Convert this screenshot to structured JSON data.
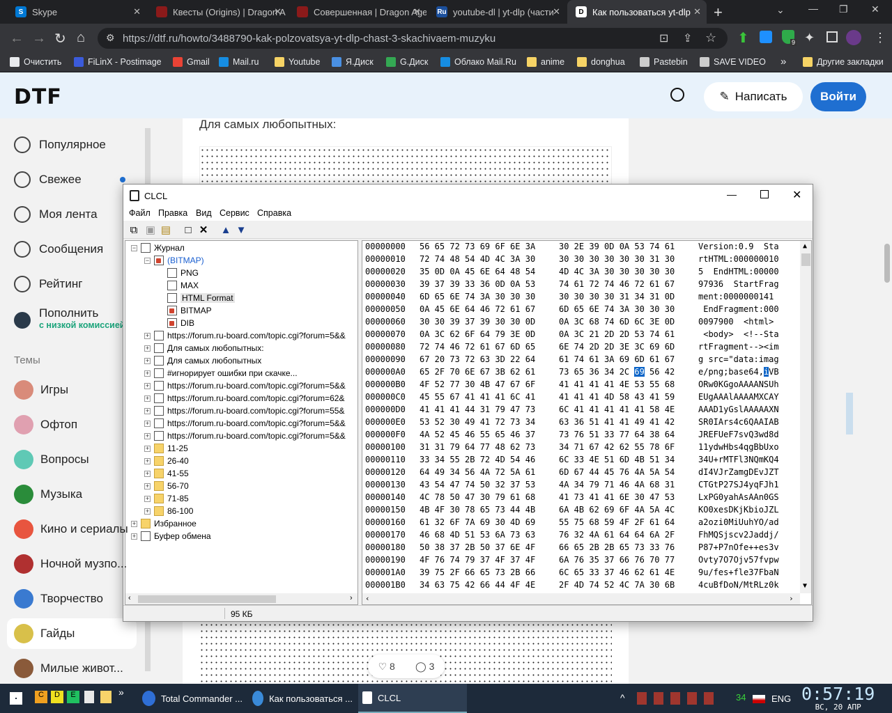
{
  "browser": {
    "tabs": [
      {
        "title": "Skype",
        "favicon_color": "#0078d4",
        "favicon_letter": "S"
      },
      {
        "title": "Квесты (Origins) | Dragon A",
        "favicon_color": "#8b1a1a",
        "favicon_letter": ""
      },
      {
        "title": "Совершенная | Dragon Age",
        "favicon_color": "#8b1a1a",
        "favicon_letter": ""
      },
      {
        "title": "youtube-dl | yt-dlp (части",
        "favicon_color": "#1b4f9c",
        "favicon_letter": "Ru"
      },
      {
        "title": "Как пользоваться yt-dlp",
        "favicon_color": "#ffffff",
        "favicon_letter": "D"
      }
    ],
    "active_tab": 4,
    "new_tab": "+",
    "url": "https://dtf.ru/howto/3488790-kak-polzovatsya-yt-dlp-chast-3-skachivaem-muzyku",
    "bookmarks": [
      {
        "label": "Очистить",
        "color": "#e8eaed"
      },
      {
        "label": "FiLinX - Postimage",
        "color": "#3b5bdb"
      },
      {
        "label": "Gmail",
        "color": "#ea4335"
      },
      {
        "label": "Mail.ru",
        "color": "#168de2"
      },
      {
        "label": "Youtube",
        "color": "#f6d365"
      },
      {
        "label": "Я.Диск",
        "color": "#4a90e2"
      },
      {
        "label": "G.Диск",
        "color": "#34a853"
      },
      {
        "label": "Облако Mail.Ru",
        "color": "#168de2"
      },
      {
        "label": "anime",
        "color": "#f6d365"
      },
      {
        "label": "donghua",
        "color": "#f6d365"
      },
      {
        "label": "Pastebin",
        "color": "#cccccc"
      },
      {
        "label": "SAVE VIDEO",
        "color": "#cccccc"
      }
    ],
    "bookmarks_more": "»",
    "other_bookmarks": "Другие закладки",
    "extension_badge": "9"
  },
  "site": {
    "logo": "DTF",
    "write_button": "Написать",
    "login_button": "Войти",
    "nav": [
      {
        "label": "Популярное"
      },
      {
        "label": "Свежее"
      },
      {
        "label": "Моя лента"
      },
      {
        "label": "Сообщения"
      },
      {
        "label": "Рейтинг"
      }
    ],
    "topup": {
      "label": "Пополнить",
      "sub": "с низкой комиссией"
    },
    "topics_heading": "Темы",
    "topics": [
      {
        "label": "Игры",
        "color": "#d98b7a"
      },
      {
        "label": "Офтоп",
        "color": "#e0a0b0"
      },
      {
        "label": "Вопросы",
        "color": "#5fc9b5"
      },
      {
        "label": "Музыка",
        "color": "#2a8c3a"
      },
      {
        "label": "Кино и сериалы",
        "color": "#e8553f"
      },
      {
        "label": "Ночной музпо...",
        "color": "#b03030"
      },
      {
        "label": "Творчество",
        "color": "#3a7ad0"
      },
      {
        "label": "Гайды",
        "color": "#d8c04a"
      },
      {
        "label": "Милые живот...",
        "color": "#8a5a3a"
      }
    ],
    "article_text": "Для самых любопытных:",
    "likes": "8",
    "comments": "3"
  },
  "clcl": {
    "title": "CLCL",
    "menu": [
      "Файл",
      "Правка",
      "Вид",
      "Сервис",
      "Справка"
    ],
    "tree": [
      {
        "label": "Журнал",
        "level": 0,
        "icon": "doc",
        "exp": "−"
      },
      {
        "label": "(BITMAP)",
        "level": 1,
        "icon": "bmp",
        "exp": "−",
        "selected": true
      },
      {
        "label": "PNG",
        "level": 2,
        "icon": "doc",
        "exp": ""
      },
      {
        "label": "MAX",
        "level": 2,
        "icon": "doc",
        "exp": ""
      },
      {
        "label": "HTML Format",
        "level": 2,
        "icon": "doc",
        "exp": "",
        "focus": true
      },
      {
        "label": "BITMAP",
        "level": 2,
        "icon": "bmp",
        "exp": ""
      },
      {
        "label": "DIB",
        "level": 2,
        "icon": "bmp",
        "exp": ""
      },
      {
        "label": "https://forum.ru-board.com/topic.cgi?forum=5&&",
        "level": 1,
        "icon": "doc",
        "exp": "+"
      },
      {
        "label": "Для самых любопытных:",
        "level": 1,
        "icon": "doc",
        "exp": "+"
      },
      {
        "label": "Для самых любопытных",
        "level": 1,
        "icon": "doc",
        "exp": "+"
      },
      {
        "label": "#игнорирует ошибки при скачке...",
        "level": 1,
        "icon": "doc",
        "exp": "+"
      },
      {
        "label": "https://forum.ru-board.com/topic.cgi?forum=5&&",
        "level": 1,
        "icon": "doc",
        "exp": "+"
      },
      {
        "label": "https://forum.ru-board.com/topic.cgi?forum=62&",
        "level": 1,
        "icon": "doc",
        "exp": "+"
      },
      {
        "label": "https://forum.ru-board.com/topic.cgi?forum=55&",
        "level": 1,
        "icon": "doc",
        "exp": "+"
      },
      {
        "label": "https://forum.ru-board.com/topic.cgi?forum=5&&",
        "level": 1,
        "icon": "doc",
        "exp": "+"
      },
      {
        "label": "https://forum.ru-board.com/topic.cgi?forum=5&&",
        "level": 1,
        "icon": "doc",
        "exp": "+"
      },
      {
        "label": "11-25",
        "level": 1,
        "icon": "folder",
        "exp": "+"
      },
      {
        "label": "26-40",
        "level": 1,
        "icon": "folder",
        "exp": "+"
      },
      {
        "label": "41-55",
        "level": 1,
        "icon": "folder",
        "exp": "+"
      },
      {
        "label": "56-70",
        "level": 1,
        "icon": "folder",
        "exp": "+"
      },
      {
        "label": "71-85",
        "level": 1,
        "icon": "folder",
        "exp": "+"
      },
      {
        "label": "86-100",
        "level": 1,
        "icon": "folder",
        "exp": "+"
      },
      {
        "label": "Избранное",
        "level": 0,
        "icon": "folder",
        "exp": "+"
      },
      {
        "label": "Буфер обмена",
        "level": 0,
        "icon": "doc",
        "exp": "+"
      }
    ],
    "hex_rows": [
      {
        "addr": "00000000",
        "h1": "56 65 72 73 69 6F 6E 3A",
        "h2": "30 2E 39 0D 0A 53 74 61",
        "text": "Version:0.9  Sta"
      },
      {
        "addr": "00000010",
        "h1": "72 74 48 54 4D 4C 3A 30",
        "h2": "30 30 30 30 30 30 31 30",
        "text": "rtHTML:000000010"
      },
      {
        "addr": "00000020",
        "h1": "35 0D 0A 45 6E 64 48 54",
        "h2": "4D 4C 3A 30 30 30 30 30",
        "text": "5  EndHTML:00000"
      },
      {
        "addr": "00000030",
        "h1": "39 37 39 33 36 0D 0A 53",
        "h2": "74 61 72 74 46 72 61 67",
        "text": "97936  StartFrag"
      },
      {
        "addr": "00000040",
        "h1": "6D 65 6E 74 3A 30 30 30",
        "h2": "30 30 30 30 31 34 31 0D",
        "text": "ment:0000000141"
      },
      {
        "addr": "00000050",
        "h1": "0A 45 6E 64 46 72 61 67",
        "h2": "6D 65 6E 74 3A 30 30 30",
        "text": " EndFragment:000"
      },
      {
        "addr": "00000060",
        "h1": "30 30 39 37 39 30 30 0D",
        "h2": "0A 3C 68 74 6D 6C 3E 0D",
        "text": "0097900  <html>"
      },
      {
        "addr": "00000070",
        "h1": "0A 3C 62 6F 64 79 3E 0D",
        "h2": "0A 3C 21 2D 2D 53 74 61",
        "text": " <body>  <!--Sta"
      },
      {
        "addr": "00000080",
        "h1": "72 74 46 72 61 67 6D 65",
        "h2": "6E 74 2D 2D 3E 3C 69 6D",
        "text": "rtFragment--><im"
      },
      {
        "addr": "00000090",
        "h1": "67 20 73 72 63 3D 22 64",
        "h2": "61 74 61 3A 69 6D 61 67",
        "text": "g src=\"data:imag"
      },
      {
        "addr": "000000A0",
        "h1": "65 2F 70 6E 67 3B 62 61",
        "h2": "73 65 36 34 2C 69 56 42",
        "text": "e/png;base64,iVB",
        "sel_hex": 13,
        "sel_char": 13
      },
      {
        "addr": "000000B0",
        "h1": "4F 52 77 30 4B 47 67 6F",
        "h2": "41 41 41 41 4E 53 55 68",
        "text": "ORw0KGgoAAAANSUh"
      },
      {
        "addr": "000000C0",
        "h1": "45 55 67 41 41 41 6C 41",
        "h2": "41 41 41 4D 58 43 41 59",
        "text": "EUgAAAlAAAAMXCAY"
      },
      {
        "addr": "000000D0",
        "h1": "41 41 41 44 31 79 47 73",
        "h2": "6C 41 41 41 41 41 58 4E",
        "text": "AAAD1yGslAAAAAXN"
      },
      {
        "addr": "000000E0",
        "h1": "53 52 30 49 41 72 73 34",
        "h2": "63 36 51 41 41 49 41 42",
        "text": "SR0IArs4c6QAAIAB"
      },
      {
        "addr": "000000F0",
        "h1": "4A 52 45 46 55 65 46 37",
        "h2": "73 76 51 33 77 64 38 64",
        "text": "JREFUeF7svQ3wd8d"
      },
      {
        "addr": "00000100",
        "h1": "31 31 79 64 77 48 62 73",
        "h2": "34 71 67 42 62 55 78 6F",
        "text": "11ydwHbs4qgBbUxo"
      },
      {
        "addr": "00000110",
        "h1": "33 34 55 2B 72 4D 54 46",
        "h2": "6C 33 4E 51 6D 4B 51 34",
        "text": "34U+rMTFl3NQmKQ4"
      },
      {
        "addr": "00000120",
        "h1": "64 49 34 56 4A 72 5A 61",
        "h2": "6D 67 44 45 76 4A 5A 54",
        "text": "dI4VJrZamgDEvJZT"
      },
      {
        "addr": "00000130",
        "h1": "43 54 47 74 50 32 37 53",
        "h2": "4A 34 79 71 46 4A 68 31",
        "text": "CTGtP27SJ4yqFJh1"
      },
      {
        "addr": "00000140",
        "h1": "4C 78 50 47 30 79 61 68",
        "h2": "41 73 41 41 6E 30 47 53",
        "text": "LxPG0yahAsAAn0GS"
      },
      {
        "addr": "00000150",
        "h1": "4B 4F 30 78 65 73 44 4B",
        "h2": "6A 4B 62 69 6F 4A 5A 4C",
        "text": "KO0xesDKjKbioJZL"
      },
      {
        "addr": "00000160",
        "h1": "61 32 6F 7A 69 30 4D 69",
        "h2": "55 75 68 59 4F 2F 61 64",
        "text": "a2ozi0MiUuhYO/ad"
      },
      {
        "addr": "00000170",
        "h1": "46 68 4D 51 53 6A 73 63",
        "h2": "76 32 4A 61 64 64 6A 2F",
        "text": "FhMQSjscv2Jaddj/"
      },
      {
        "addr": "00000180",
        "h1": "50 38 37 2B 50 37 6E 4F",
        "h2": "66 65 2B 2B 65 73 33 76",
        "text": "P87+P7nOfe++es3v"
      },
      {
        "addr": "00000190",
        "h1": "4F 76 74 79 37 4F 37 4F",
        "h2": "6A 76 35 37 66 76 70 77",
        "text": "Ovty7O7Ojv57fvpw"
      },
      {
        "addr": "000001A0",
        "h1": "39 75 2F 66 65 73 2B 66",
        "h2": "6C 65 33 37 46 62 61 4E",
        "text": "9u/fes+fle37FbaN"
      },
      {
        "addr": "000001B0",
        "h1": "34 63 75 42 66 44 4F 4E",
        "h2": "2F 4D 74 52 4C 7A 30 6B",
        "text": "4cuBfDoN/MtRLz0k"
      }
    ],
    "status": "95 КБ"
  },
  "taskbar": {
    "apps": [
      {
        "label": "Total Commander ...",
        "color": "#2f6fd6"
      },
      {
        "label": "Как пользоваться ...",
        "color": "#3a8ad8"
      },
      {
        "label": "CLCL",
        "color": "#ffffff"
      }
    ],
    "tray_counter": "34",
    "language": "ENG",
    "time": "0:57:19",
    "date": "ВС, 20 АПР"
  }
}
